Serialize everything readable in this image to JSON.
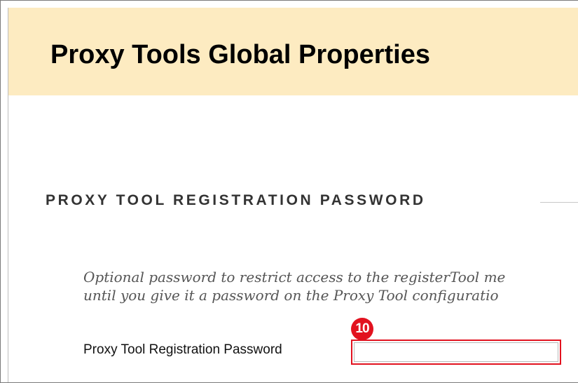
{
  "header": {
    "title": "Proxy Tools Global Properties"
  },
  "section": {
    "heading": "PROXY TOOL REGISTRATION PASSWORD",
    "help_lines": [
      "Optional password to restrict access to the registerTool me",
      "until you give it a password on the Proxy Tool configuratio"
    ]
  },
  "form": {
    "password_label": "Proxy Tool Registration Password",
    "password_value": ""
  },
  "annotation": {
    "step_number": "10",
    "callout_color": "#e2121f"
  },
  "colors": {
    "header_bg": "#fdebc1",
    "heading_text": "#333333",
    "help_text": "#555555"
  }
}
